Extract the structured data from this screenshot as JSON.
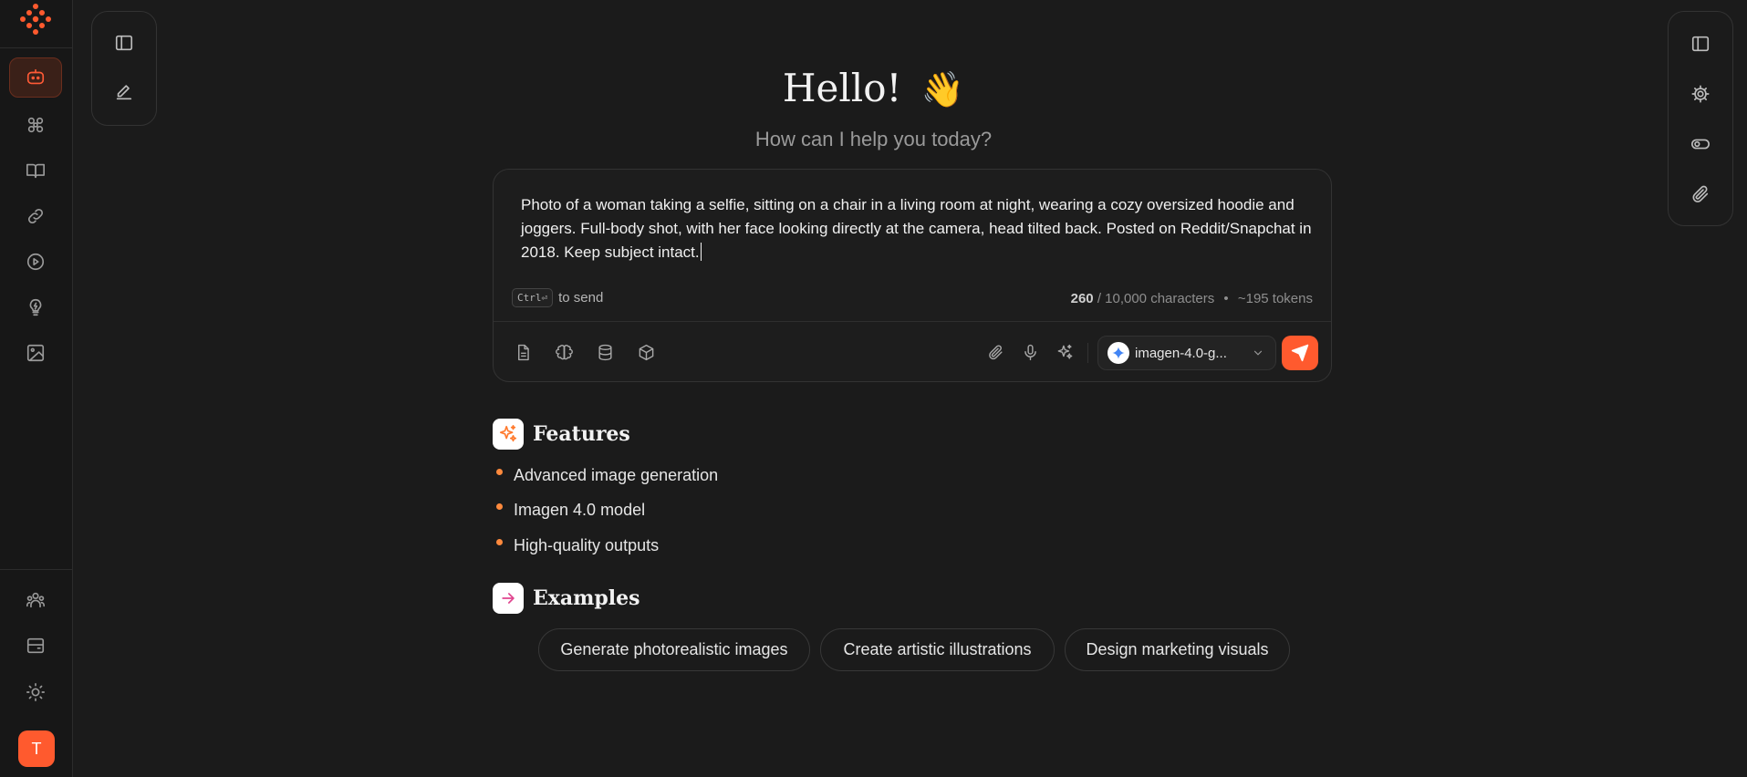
{
  "greeting": {
    "title": "Hello!",
    "emoji": "👋",
    "subtitle": "How can I help you today?"
  },
  "composer": {
    "prompt": "Photo of a woman taking a selfie, sitting on a chair in a living room at night, wearing a cozy oversized hoodie and joggers. Full-body shot, with her face looking directly at the camera, head tilted back. Posted on Reddit/Snapchat in 2018. Keep subject intact.",
    "shortcut_key": "Ctrl⏎",
    "shortcut_text": "to send",
    "char_count": "260",
    "char_limit": "/ 10,000 characters",
    "separator": "•",
    "tokens": "~195 tokens",
    "model": "imagen-4.0-g..."
  },
  "sidebar": {
    "avatar_letter": "T"
  },
  "features": {
    "title": "Features",
    "items": [
      "Advanced image generation",
      "Imagen 4.0 model",
      "High-quality outputs"
    ]
  },
  "examples": {
    "title": "Examples",
    "items": [
      "Generate photorealistic images",
      "Create artistic illustrations",
      "Design marketing visuals"
    ]
  },
  "colors": {
    "accent": "#ff5a2e",
    "background": "#1b1b1b",
    "bullet": "#ff8a3d"
  }
}
